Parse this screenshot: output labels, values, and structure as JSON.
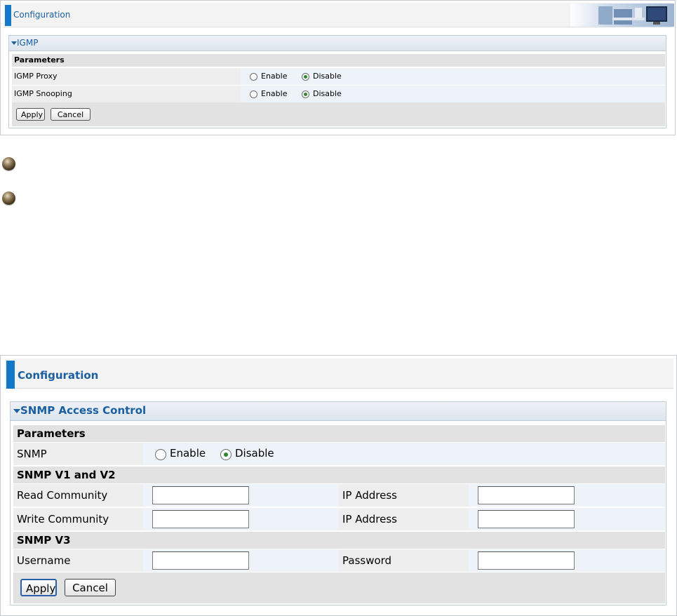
{
  "igmp_panel": {
    "header_title": "Configuration",
    "section_title": "IGMP",
    "params_heading": "Parameters",
    "rows": [
      {
        "label": "IGMP Proxy",
        "options": [
          "Enable",
          "Disable"
        ],
        "selected": "Disable"
      },
      {
        "label": "IGMP Snooping",
        "options": [
          "Enable",
          "Disable"
        ],
        "selected": "Disable"
      }
    ],
    "apply_label": "Apply",
    "cancel_label": "Cancel"
  },
  "snmp_panel": {
    "header_title": "Configuration",
    "section_title": "SNMP Access Control",
    "params_heading": "Parameters",
    "snmp_row": {
      "label": "SNMP",
      "options": [
        "Enable",
        "Disable"
      ],
      "selected": "Disable"
    },
    "v1v2_heading": "SNMP V1 and V2",
    "read_community": {
      "label": "Read Community",
      "value": "",
      "ip_label": "IP Address",
      "ip_value": ""
    },
    "write_community": {
      "label": "Write Community",
      "value": "",
      "ip_label": "IP Address",
      "ip_value": ""
    },
    "v3_heading": "SNMP V3",
    "username": {
      "label": "Username",
      "value": ""
    },
    "password": {
      "label": "Password",
      "value": ""
    },
    "apply_label": "Apply",
    "cancel_label": "Cancel"
  },
  "colors": {
    "accent_blue": "#1478c8",
    "title_text": "#1a5fa0",
    "radio_selected": "#2c8a2c"
  }
}
